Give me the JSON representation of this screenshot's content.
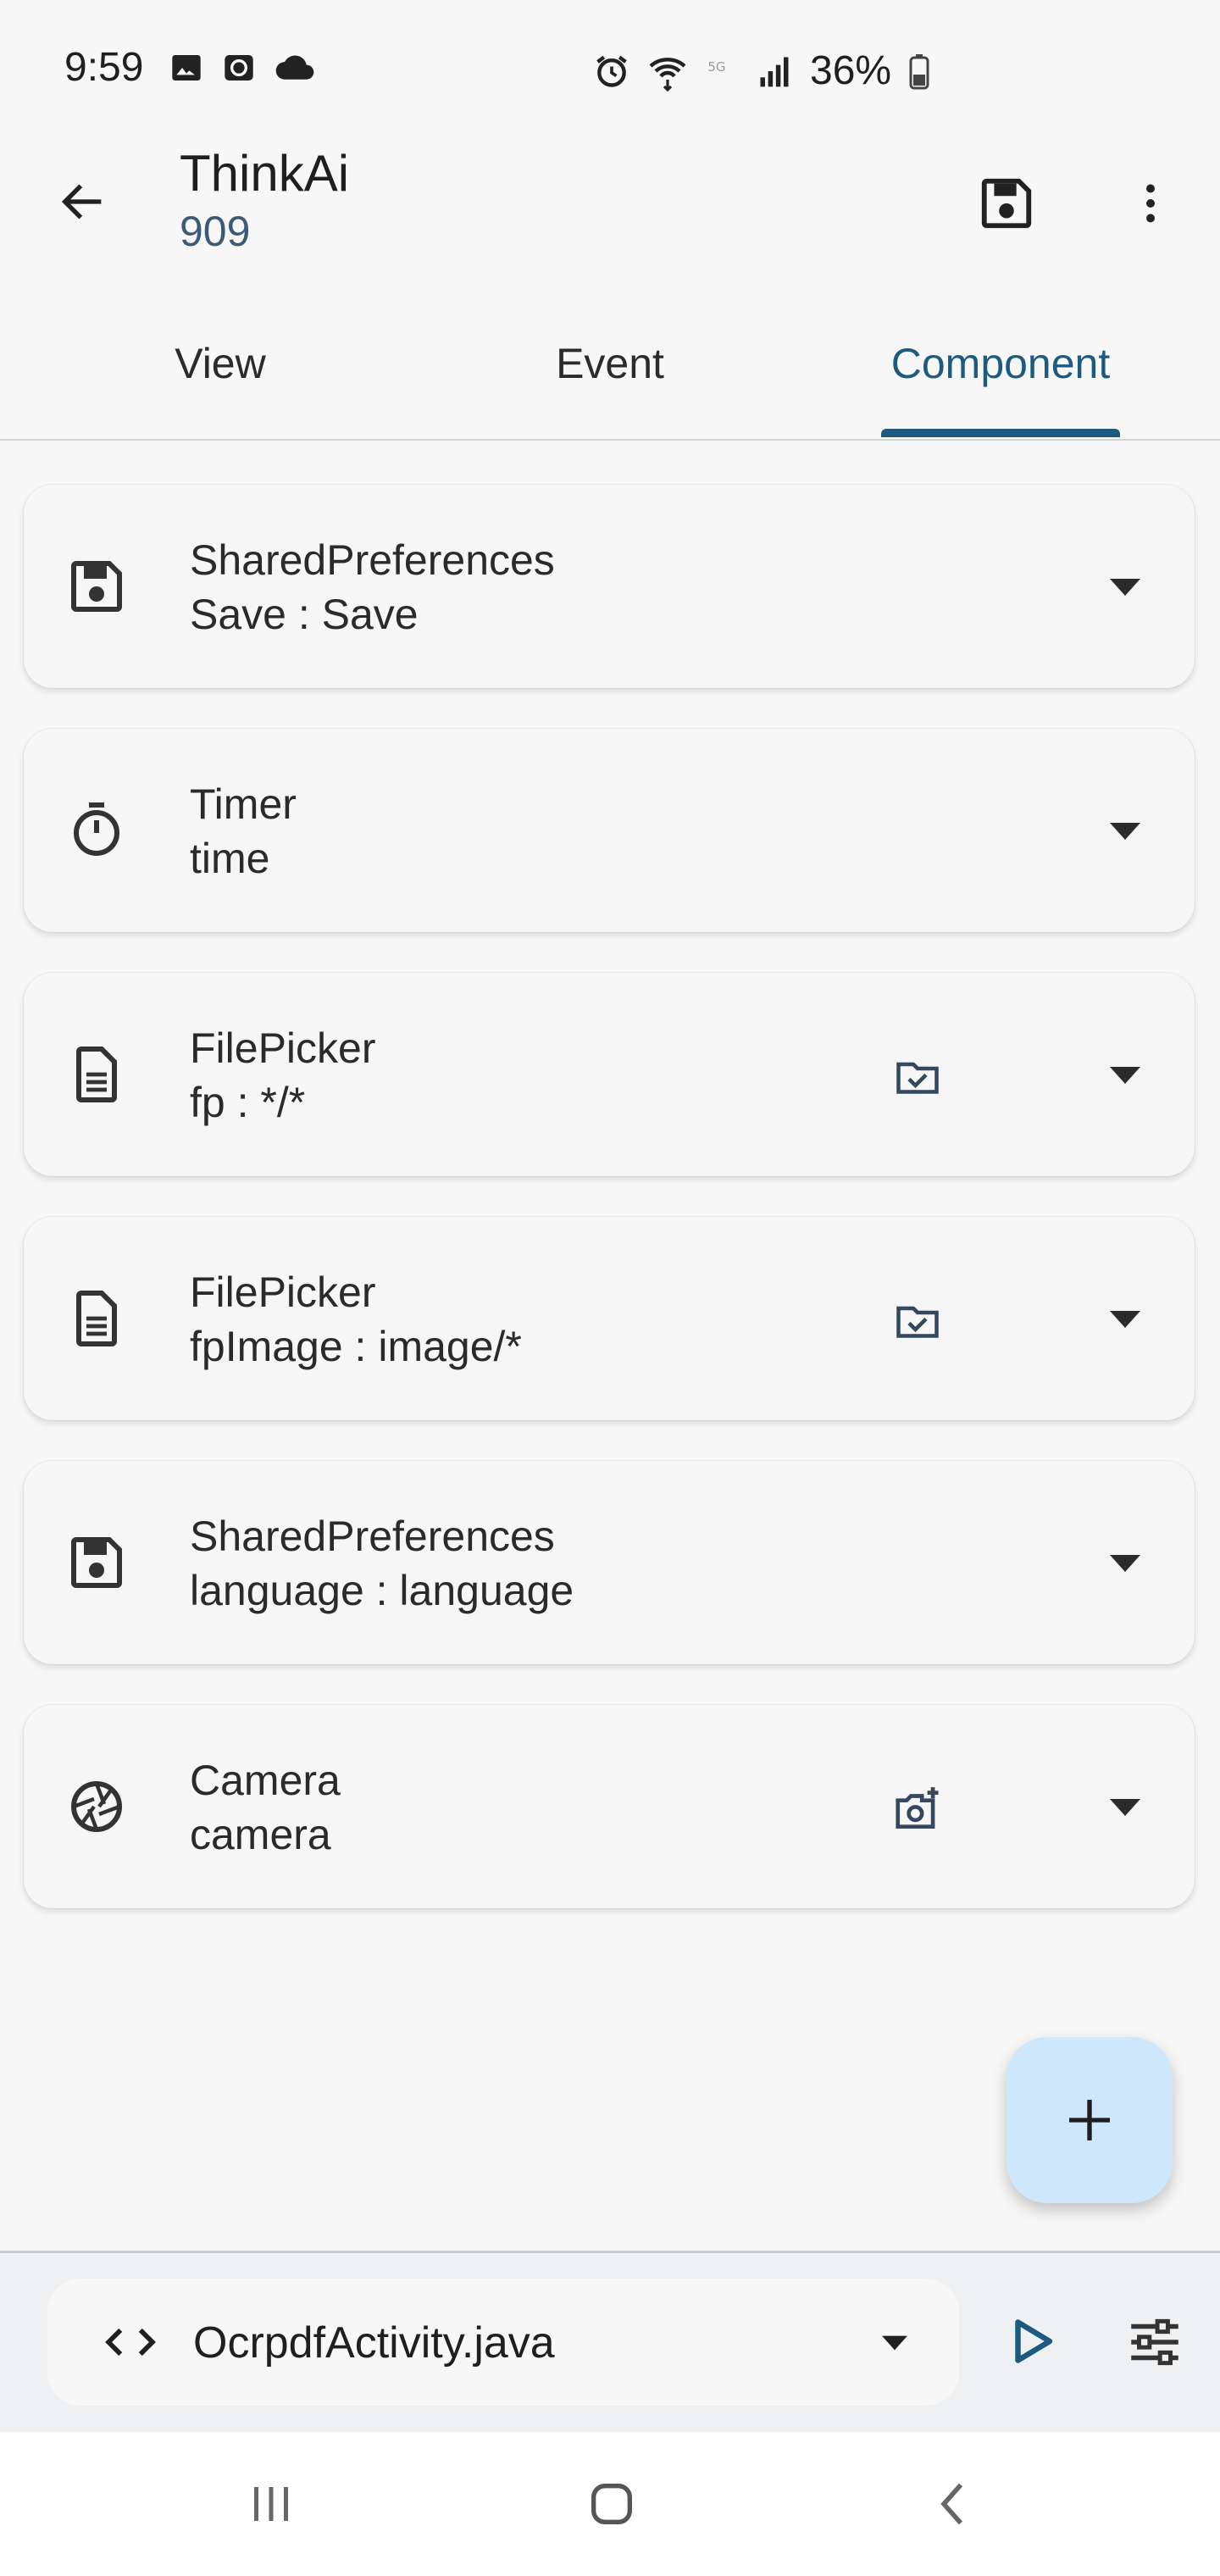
{
  "status_bar": {
    "time": "9:59",
    "battery": "36%",
    "left_icons": [
      "image-icon",
      "alarm-app-icon",
      "cloud-icon"
    ],
    "right_icons": [
      "alarm-icon",
      "wifi-icon",
      "5g-icon",
      "signal-icon",
      "battery-icon"
    ]
  },
  "app_bar": {
    "title": "ThinkAi",
    "subtitle": "909"
  },
  "tabs": [
    {
      "label": "View",
      "active": false
    },
    {
      "label": "Event",
      "active": false
    },
    {
      "label": "Component",
      "active": true
    }
  ],
  "components": [
    {
      "type": "SharedPreferences",
      "detail": "Save : Save",
      "icon": "save-icon",
      "action_icon": ""
    },
    {
      "type": "Timer",
      "detail": "time",
      "icon": "timer-icon",
      "action_icon": ""
    },
    {
      "type": "FilePicker",
      "detail": "fp : */*",
      "icon": "file-icon",
      "action_icon": "folder-check-icon"
    },
    {
      "type": "FilePicker",
      "detail": "fpImage : image/*",
      "icon": "file-icon",
      "action_icon": "folder-check-icon"
    },
    {
      "type": "SharedPreferences",
      "detail": "language : language",
      "icon": "save-icon",
      "action_icon": ""
    },
    {
      "type": "Camera",
      "detail": "camera",
      "icon": "camera-shutter-icon",
      "action_icon": "add-photo-icon"
    }
  ],
  "bottom_bar": {
    "file_name": "OcrpdfActivity.java"
  },
  "colors": {
    "accent": "#1c5a80",
    "fab_bg": "#cfe7fb",
    "background": "#f7f7f8"
  }
}
